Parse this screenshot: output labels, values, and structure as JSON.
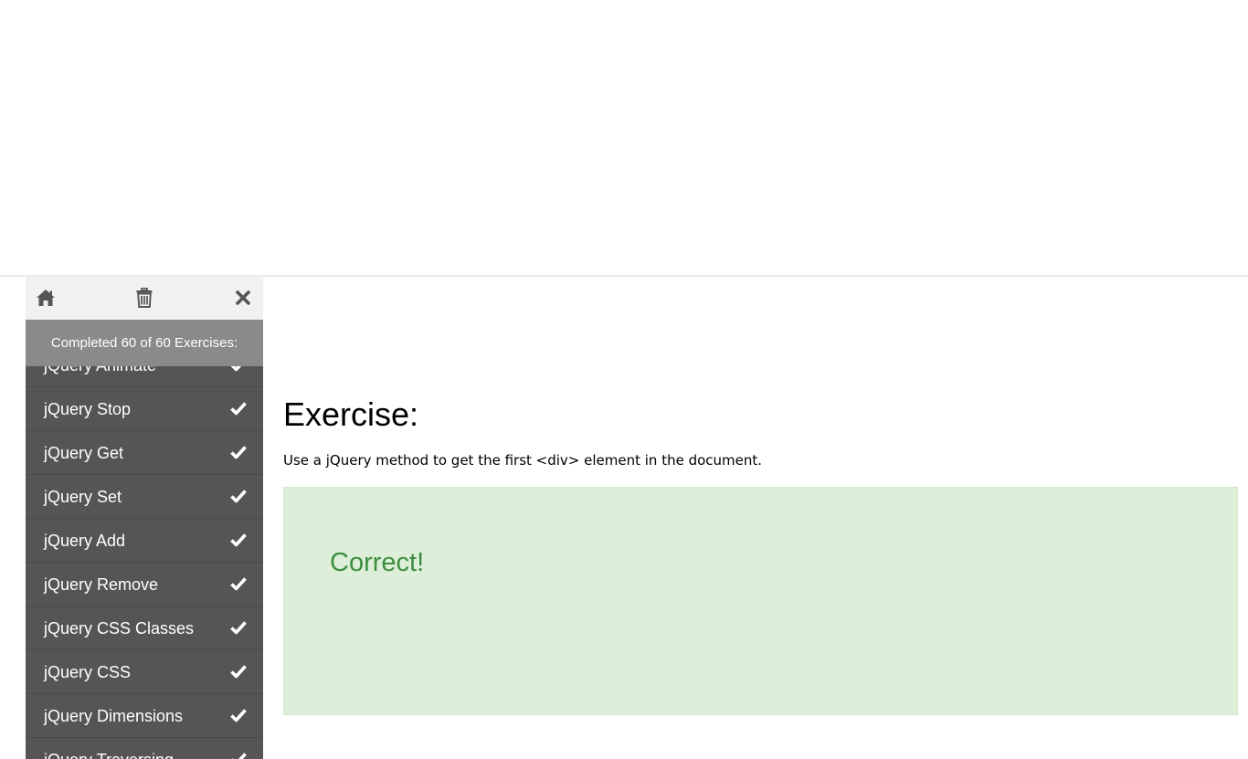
{
  "sidebar": {
    "toolbar": {
      "home_icon": "home-icon",
      "trash_icon": "trash-icon",
      "close_icon": "close-icon"
    },
    "status": "Completed 60 of 60 Exercises:",
    "items": [
      {
        "label": "jQuery Animate",
        "completed": true
      },
      {
        "label": "jQuery Stop",
        "completed": true
      },
      {
        "label": "jQuery Get",
        "completed": true
      },
      {
        "label": "jQuery Set",
        "completed": true
      },
      {
        "label": "jQuery Add",
        "completed": true
      },
      {
        "label": "jQuery Remove",
        "completed": true
      },
      {
        "label": "jQuery CSS Classes",
        "completed": true
      },
      {
        "label": "jQuery CSS",
        "completed": true
      },
      {
        "label": "jQuery Dimensions",
        "completed": true
      },
      {
        "label": "jQuery Traversing",
        "completed": true
      }
    ]
  },
  "main": {
    "title": "Exercise:",
    "instruction": "Use a jQuery method to get the first <div> element in the document.",
    "result": "Correct!"
  },
  "colors": {
    "sidebar_bg": "#555555",
    "toolbar_bg": "#f1f1f1",
    "status_bg": "#8a8a8a",
    "result_bg": "#ddefd8",
    "result_text": "#3e8e41"
  }
}
